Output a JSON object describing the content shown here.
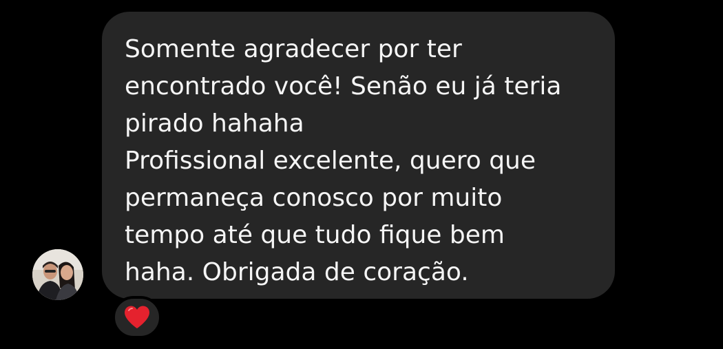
{
  "message": {
    "lines": [
      "Somente agradecer por ter",
      "encontrado você! Senão eu já teria",
      "pirado hahaha",
      "Profissional excelente, quero que",
      "permaneça conosco por muito",
      "tempo até que tudo fique bem",
      "haha. Obrigada de coração."
    ]
  },
  "sender": {
    "avatar_icon": "profile-photo-couple"
  },
  "reaction": {
    "icon": "red-heart-icon",
    "color": "#e5222e"
  },
  "colors": {
    "background": "#000000",
    "bubble": "#262626",
    "text": "#f5f5f5"
  }
}
